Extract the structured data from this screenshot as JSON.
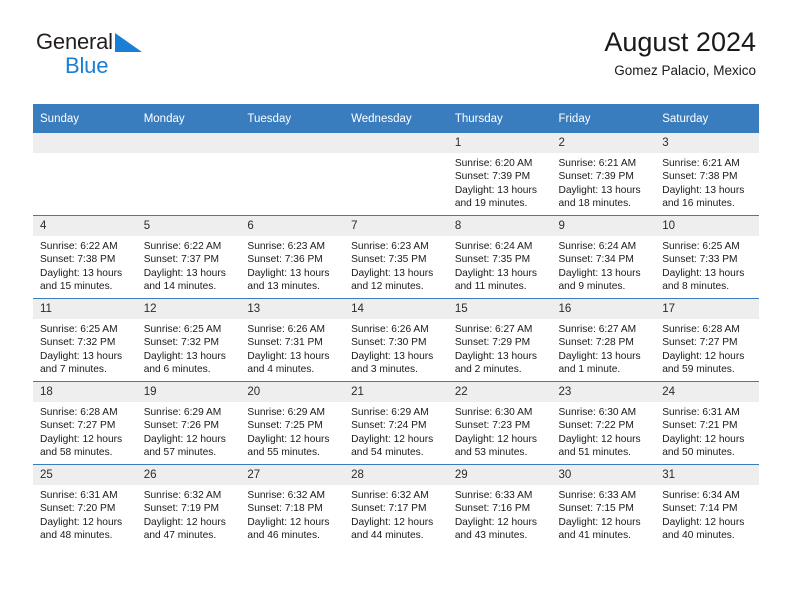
{
  "brand": {
    "line1": "General",
    "line2": "Blue",
    "triangle_color": "#1a7fd4",
    "text_color": "#231f20"
  },
  "header": {
    "title": "August 2024",
    "subtitle": "Gomez Palacio, Mexico"
  },
  "theme": {
    "header_blue": "#3a7dbf",
    "daynum_bg": "#eeeeee",
    "text": "#1a1a1a"
  },
  "weekday_headers": [
    "Sunday",
    "Monday",
    "Tuesday",
    "Wednesday",
    "Thursday",
    "Friday",
    "Saturday"
  ],
  "labels": {
    "sunrise": "Sunrise:",
    "sunset": "Sunset:",
    "daylight": "Daylight:"
  },
  "weeks": [
    [
      {
        "day": "",
        "empty": true
      },
      {
        "day": "",
        "empty": true
      },
      {
        "day": "",
        "empty": true
      },
      {
        "day": "",
        "empty": true
      },
      {
        "day": "1",
        "sunrise": "Sunrise: 6:20 AM",
        "sunset": "Sunset: 7:39 PM",
        "daylight_l1": "Daylight: 13 hours",
        "daylight_l2": "and 19 minutes."
      },
      {
        "day": "2",
        "sunrise": "Sunrise: 6:21 AM",
        "sunset": "Sunset: 7:39 PM",
        "daylight_l1": "Daylight: 13 hours",
        "daylight_l2": "and 18 minutes."
      },
      {
        "day": "3",
        "sunrise": "Sunrise: 6:21 AM",
        "sunset": "Sunset: 7:38 PM",
        "daylight_l1": "Daylight: 13 hours",
        "daylight_l2": "and 16 minutes."
      }
    ],
    [
      {
        "day": "4",
        "sunrise": "Sunrise: 6:22 AM",
        "sunset": "Sunset: 7:38 PM",
        "daylight_l1": "Daylight: 13 hours",
        "daylight_l2": "and 15 minutes."
      },
      {
        "day": "5",
        "sunrise": "Sunrise: 6:22 AM",
        "sunset": "Sunset: 7:37 PM",
        "daylight_l1": "Daylight: 13 hours",
        "daylight_l2": "and 14 minutes."
      },
      {
        "day": "6",
        "sunrise": "Sunrise: 6:23 AM",
        "sunset": "Sunset: 7:36 PM",
        "daylight_l1": "Daylight: 13 hours",
        "daylight_l2": "and 13 minutes."
      },
      {
        "day": "7",
        "sunrise": "Sunrise: 6:23 AM",
        "sunset": "Sunset: 7:35 PM",
        "daylight_l1": "Daylight: 13 hours",
        "daylight_l2": "and 12 minutes."
      },
      {
        "day": "8",
        "sunrise": "Sunrise: 6:24 AM",
        "sunset": "Sunset: 7:35 PM",
        "daylight_l1": "Daylight: 13 hours",
        "daylight_l2": "and 11 minutes."
      },
      {
        "day": "9",
        "sunrise": "Sunrise: 6:24 AM",
        "sunset": "Sunset: 7:34 PM",
        "daylight_l1": "Daylight: 13 hours",
        "daylight_l2": "and 9 minutes."
      },
      {
        "day": "10",
        "sunrise": "Sunrise: 6:25 AM",
        "sunset": "Sunset: 7:33 PM",
        "daylight_l1": "Daylight: 13 hours",
        "daylight_l2": "and 8 minutes."
      }
    ],
    [
      {
        "day": "11",
        "sunrise": "Sunrise: 6:25 AM",
        "sunset": "Sunset: 7:32 PM",
        "daylight_l1": "Daylight: 13 hours",
        "daylight_l2": "and 7 minutes."
      },
      {
        "day": "12",
        "sunrise": "Sunrise: 6:25 AM",
        "sunset": "Sunset: 7:32 PM",
        "daylight_l1": "Daylight: 13 hours",
        "daylight_l2": "and 6 minutes."
      },
      {
        "day": "13",
        "sunrise": "Sunrise: 6:26 AM",
        "sunset": "Sunset: 7:31 PM",
        "daylight_l1": "Daylight: 13 hours",
        "daylight_l2": "and 4 minutes."
      },
      {
        "day": "14",
        "sunrise": "Sunrise: 6:26 AM",
        "sunset": "Sunset: 7:30 PM",
        "daylight_l1": "Daylight: 13 hours",
        "daylight_l2": "and 3 minutes."
      },
      {
        "day": "15",
        "sunrise": "Sunrise: 6:27 AM",
        "sunset": "Sunset: 7:29 PM",
        "daylight_l1": "Daylight: 13 hours",
        "daylight_l2": "and 2 minutes."
      },
      {
        "day": "16",
        "sunrise": "Sunrise: 6:27 AM",
        "sunset": "Sunset: 7:28 PM",
        "daylight_l1": "Daylight: 13 hours",
        "daylight_l2": "and 1 minute."
      },
      {
        "day": "17",
        "sunrise": "Sunrise: 6:28 AM",
        "sunset": "Sunset: 7:27 PM",
        "daylight_l1": "Daylight: 12 hours",
        "daylight_l2": "and 59 minutes."
      }
    ],
    [
      {
        "day": "18",
        "sunrise": "Sunrise: 6:28 AM",
        "sunset": "Sunset: 7:27 PM",
        "daylight_l1": "Daylight: 12 hours",
        "daylight_l2": "and 58 minutes."
      },
      {
        "day": "19",
        "sunrise": "Sunrise: 6:29 AM",
        "sunset": "Sunset: 7:26 PM",
        "daylight_l1": "Daylight: 12 hours",
        "daylight_l2": "and 57 minutes."
      },
      {
        "day": "20",
        "sunrise": "Sunrise: 6:29 AM",
        "sunset": "Sunset: 7:25 PM",
        "daylight_l1": "Daylight: 12 hours",
        "daylight_l2": "and 55 minutes."
      },
      {
        "day": "21",
        "sunrise": "Sunrise: 6:29 AM",
        "sunset": "Sunset: 7:24 PM",
        "daylight_l1": "Daylight: 12 hours",
        "daylight_l2": "and 54 minutes."
      },
      {
        "day": "22",
        "sunrise": "Sunrise: 6:30 AM",
        "sunset": "Sunset: 7:23 PM",
        "daylight_l1": "Daylight: 12 hours",
        "daylight_l2": "and 53 minutes."
      },
      {
        "day": "23",
        "sunrise": "Sunrise: 6:30 AM",
        "sunset": "Sunset: 7:22 PM",
        "daylight_l1": "Daylight: 12 hours",
        "daylight_l2": "and 51 minutes."
      },
      {
        "day": "24",
        "sunrise": "Sunrise: 6:31 AM",
        "sunset": "Sunset: 7:21 PM",
        "daylight_l1": "Daylight: 12 hours",
        "daylight_l2": "and 50 minutes."
      }
    ],
    [
      {
        "day": "25",
        "sunrise": "Sunrise: 6:31 AM",
        "sunset": "Sunset: 7:20 PM",
        "daylight_l1": "Daylight: 12 hours",
        "daylight_l2": "and 48 minutes."
      },
      {
        "day": "26",
        "sunrise": "Sunrise: 6:32 AM",
        "sunset": "Sunset: 7:19 PM",
        "daylight_l1": "Daylight: 12 hours",
        "daylight_l2": "and 47 minutes."
      },
      {
        "day": "27",
        "sunrise": "Sunrise: 6:32 AM",
        "sunset": "Sunset: 7:18 PM",
        "daylight_l1": "Daylight: 12 hours",
        "daylight_l2": "and 46 minutes."
      },
      {
        "day": "28",
        "sunrise": "Sunrise: 6:32 AM",
        "sunset": "Sunset: 7:17 PM",
        "daylight_l1": "Daylight: 12 hours",
        "daylight_l2": "and 44 minutes."
      },
      {
        "day": "29",
        "sunrise": "Sunrise: 6:33 AM",
        "sunset": "Sunset: 7:16 PM",
        "daylight_l1": "Daylight: 12 hours",
        "daylight_l2": "and 43 minutes."
      },
      {
        "day": "30",
        "sunrise": "Sunrise: 6:33 AM",
        "sunset": "Sunset: 7:15 PM",
        "daylight_l1": "Daylight: 12 hours",
        "daylight_l2": "and 41 minutes."
      },
      {
        "day": "31",
        "sunrise": "Sunrise: 6:34 AM",
        "sunset": "Sunset: 7:14 PM",
        "daylight_l1": "Daylight: 12 hours",
        "daylight_l2": "and 40 minutes."
      }
    ]
  ]
}
